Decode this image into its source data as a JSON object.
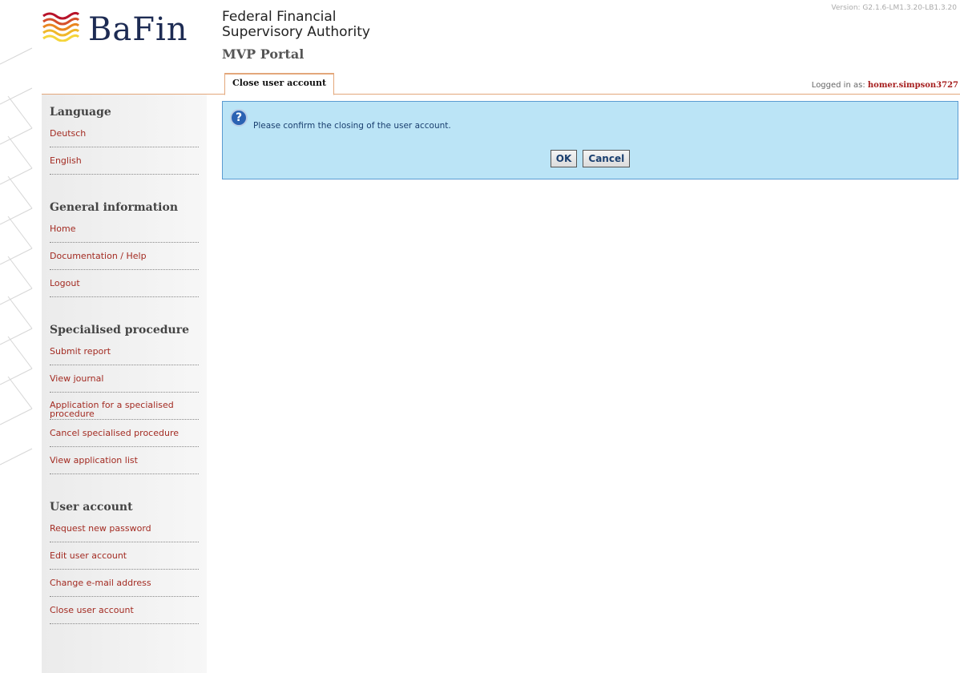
{
  "header": {
    "logo_text": "BaFin",
    "org_line1": "Federal Financial",
    "org_line2": "Supervisory Authority",
    "portal": "MVP Portal",
    "version": "Version: G2.1.6-LM1.3.20-LB1.3.20"
  },
  "tab": {
    "label": "Close user account"
  },
  "user": {
    "prefix": "Logged in as: ",
    "name": "homer.simpson3727"
  },
  "sidebar": {
    "sections": [
      {
        "heading": "Language",
        "items": [
          "Deutsch",
          "English"
        ]
      },
      {
        "heading": "General information",
        "items": [
          "Home",
          "Documentation / Help",
          "Logout"
        ]
      },
      {
        "heading": "Specialised procedure",
        "items": [
          "Submit report",
          "View journal",
          "Application for a specialised procedure",
          "Cancel specialised procedure",
          "View application list"
        ]
      },
      {
        "heading": "User account",
        "items": [
          "Request new password",
          "Edit user account",
          "Change e-mail address",
          "Close user account"
        ]
      }
    ]
  },
  "dialog": {
    "message": "Please confirm the closing of the user account.",
    "ok_label": "OK",
    "cancel_label": "Cancel"
  },
  "colors": {
    "accent": "#e3a77b",
    "link": "#a32b22",
    "dialog_bg": "#bbe4f6"
  }
}
